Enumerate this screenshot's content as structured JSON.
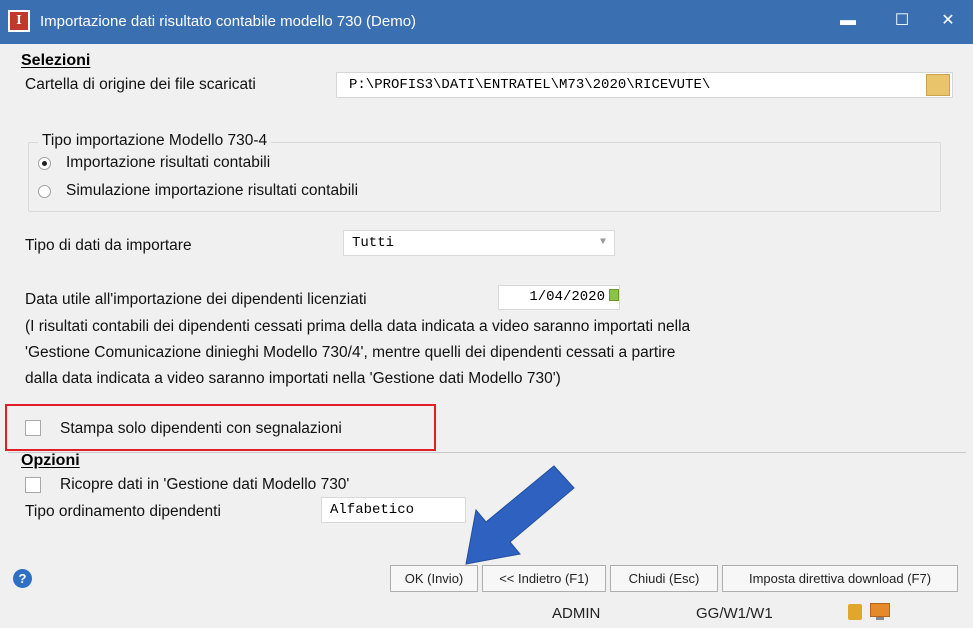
{
  "window": {
    "title": "Importazione dati risultato contabile modello 730  (Demo)",
    "app_icon_letter": "I"
  },
  "selezioni": {
    "section_title": "Selezioni",
    "cartella_label": "Cartella di origine dei file scaricati",
    "cartella_value": "P:\\PROFIS3\\DATI\\ENTRATEL\\M73\\2020\\RICEVUTE\\",
    "tipo_importazione": {
      "legend": "Tipo importazione Modello 730-4",
      "options": [
        {
          "label": "Importazione risultati contabili",
          "selected": true
        },
        {
          "label": "Simulazione importazione risultati contabili",
          "selected": false
        }
      ]
    },
    "tipo_dati_label": "Tipo di dati da importare",
    "tipo_dati_value": "Tutti",
    "data_utile_label": "Data utile all'importazione dei dipendenti licenziati",
    "data_utile_value": "1/04/2020",
    "note_lines": [
      "(I risultati contabili dei dipendenti cessati prima della data indicata a video saranno importati nella",
      "'Gestione Comunicazione dinieghi Modello 730/4', mentre quelli dei dipendenti cessati a partire",
      "dalla data indicata a video saranno importati nella 'Gestione dati Modello 730')"
    ],
    "stampa_label": "Stampa solo dipendenti con segnalazioni",
    "stampa_checked": false
  },
  "opzioni": {
    "section_title": "Opzioni",
    "ricopre_label": "Ricopre dati in 'Gestione dati Modello 730'",
    "ricopre_checked": false,
    "ordinamento_label": "Tipo ordinamento dipendenti",
    "ordinamento_value": "Alfabetico"
  },
  "buttons": {
    "ok": "OK (Invio)",
    "indietro": "<< Indietro (F1)",
    "chiudi": "Chiudi (Esc)",
    "imposta": "Imposta direttiva download (F7)"
  },
  "status": {
    "user": "ADMIN",
    "session": "GG/W1/W1"
  },
  "colors": {
    "titlebar": "#3a6fb2",
    "highlight_border": "#e11d2a",
    "arrow": "#2f62c0"
  }
}
